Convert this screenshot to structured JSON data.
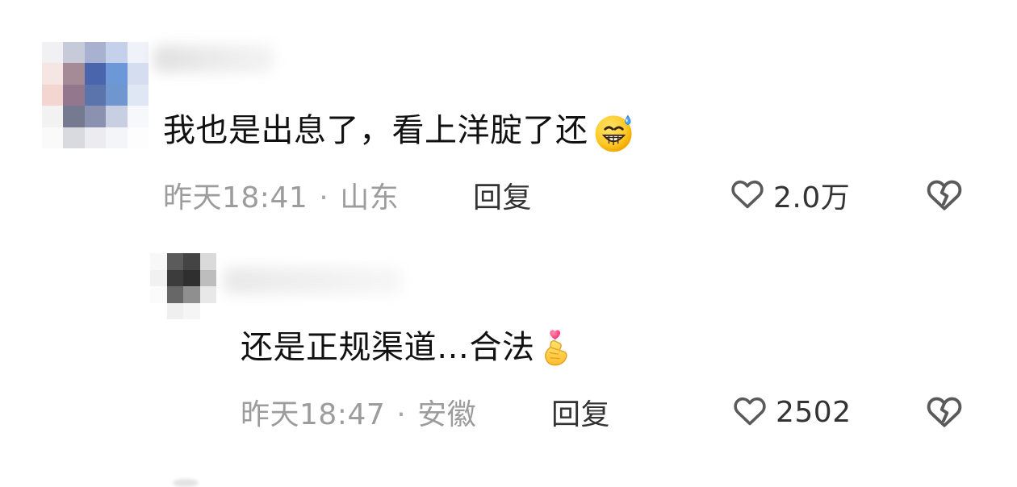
{
  "comments": [
    {
      "username": "",
      "text": "我也是出息了，看上洋腚了还",
      "emoji": "sweat-grin-emoji",
      "time": "昨天18:41",
      "separator": "·",
      "location": "山东",
      "reply_label": "回复",
      "like_count": "2.0万"
    },
    {
      "username": "",
      "text": "还是正规渠道…合法",
      "emoji": "finger-heart-emoji",
      "time": "昨天18:47",
      "separator": "·",
      "location": "安徽",
      "reply_label": "回复",
      "like_count": "2502"
    }
  ],
  "colors": {
    "text": "#111111",
    "meta": "#9c9c9c",
    "action": "#333333",
    "icon": "#5a5a5a"
  }
}
